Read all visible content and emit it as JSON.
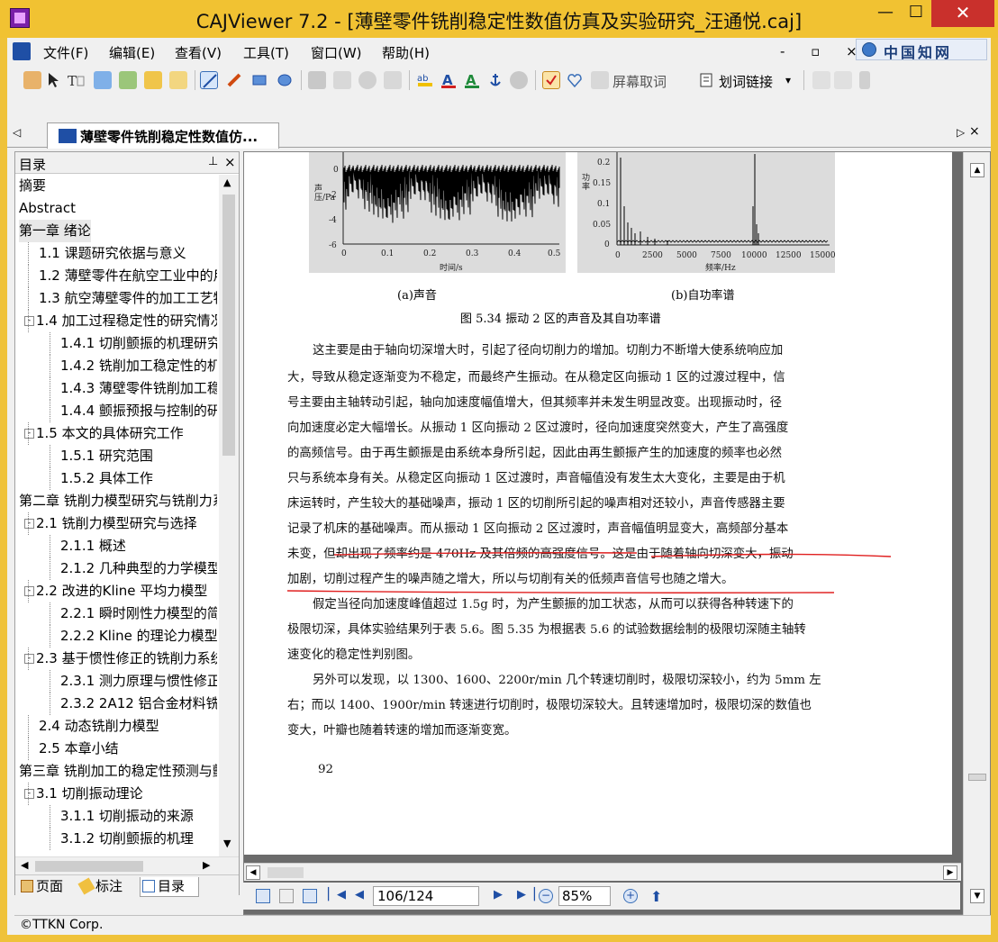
{
  "window": {
    "title": "CAJViewer 7.2 - [薄壁零件铣削稳定性数值仿真及实验研究_汪通悦.caj]",
    "minimize": "—",
    "maximize": "☐",
    "close": "✕"
  },
  "menu": {
    "items": [
      "文件(F)",
      "编辑(E)",
      "查看(V)",
      "工具(T)",
      "窗口(W)",
      "帮助(H)"
    ],
    "mdi_controls": "- ▫ ×",
    "cnki_label": "中国知网"
  },
  "toolbar": {
    "screen_translate_label": "屏幕取词",
    "word_link_label": "划词链接",
    "dropdown_arrow": "▾"
  },
  "doc_tab": {
    "title": "薄壁零件铣削稳定性数值仿...",
    "prev_arrow": "◁",
    "next_arrow": "▷",
    "close": "×"
  },
  "sidebar": {
    "title": "目录",
    "pin": "⊥",
    "close": "×",
    "toc": [
      {
        "label": "摘要",
        "level": 0
      },
      {
        "label": "Abstract",
        "level": 0
      },
      {
        "label": "第一章 绪论",
        "level": 0,
        "selected": true
      },
      {
        "label": "1.1 课题研究依据与意义",
        "level": 1
      },
      {
        "label": "1.2 薄壁零件在航空工业中的用",
        "level": 1
      },
      {
        "label": "1.3 航空薄壁零件的加工工艺特",
        "level": 1
      },
      {
        "label": "1.4 加工过程稳定性的研究情况",
        "level": 1,
        "expander": "-"
      },
      {
        "label": "1.4.1 切削颤振的机理研究",
        "level": 2
      },
      {
        "label": "1.4.2 铣削加工稳定性的机",
        "level": 2
      },
      {
        "label": "1.4.3 薄壁零件铣削加工稳",
        "level": 2
      },
      {
        "label": "1.4.4 颤振预报与控制的研",
        "level": 2
      },
      {
        "label": "1.5 本文的具体研究工作",
        "level": 1,
        "expander": "-"
      },
      {
        "label": "1.5.1 研究范围",
        "level": 2
      },
      {
        "label": "1.5.2 具体工作",
        "level": 2
      },
      {
        "label": "第二章 铣削力模型研究与铣削力系",
        "level": 0
      },
      {
        "label": "2.1 铣削力模型研究与选择",
        "level": 1,
        "expander": "-"
      },
      {
        "label": "2.1.1 概述",
        "level": 2
      },
      {
        "label": "2.1.2 几种典型的力学模型",
        "level": 2
      },
      {
        "label": "2.2 改进的Kline 平均力模型",
        "level": 1,
        "expander": "-"
      },
      {
        "label": "2.2.1 瞬时刚性力模型的简",
        "level": 2
      },
      {
        "label": "2.2.2 Kline 的理论力模型",
        "level": 2
      },
      {
        "label": "2.3 基于惯性修正的铣削力系统",
        "level": 1,
        "expander": "-"
      },
      {
        "label": "2.3.1 测力原理与惯性修正",
        "level": 2
      },
      {
        "label": "2.3.2 2A12 铝合金材料铣",
        "level": 2
      },
      {
        "label": "2.4 动态铣削力模型",
        "level": 1
      },
      {
        "label": "2.5 本章小结",
        "level": 1
      },
      {
        "label": "第三章 铣削加工的稳定性预测与颤",
        "level": 0
      },
      {
        "label": "3.1 切削振动理论",
        "level": 1,
        "expander": "-"
      },
      {
        "label": "3.1.1 切削振动的来源",
        "level": 2
      },
      {
        "label": "3.1.2 切削颤振的机理",
        "level": 2
      }
    ],
    "tabs": [
      "页面",
      "标注",
      "目录"
    ],
    "active_tab": 2
  },
  "navigation": {
    "page_value": "106/124",
    "zoom_value": "85%"
  },
  "status": {
    "text": "©TTKN Corp."
  },
  "page": {
    "figure_a": {
      "caption": "(a)声音",
      "ylabel": "声压/Pa",
      "xlabel": "时间/s",
      "yticks": [
        "0",
        "-2",
        "-4",
        "-6"
      ],
      "xticks": [
        "0",
        "0.1",
        "0.2",
        "0.3",
        "0.4",
        "0.5"
      ]
    },
    "figure_b": {
      "caption": "(b)自功率谱",
      "ylabel": "功率",
      "xlabel": "频率/Hz",
      "yticks": [
        "0.2",
        "0.15",
        "0.1",
        "0.05",
        "0"
      ],
      "xticks": [
        "0",
        "2500",
        "5000",
        "7500",
        "10000",
        "12500",
        "15000"
      ]
    },
    "figure_caption": "图 5.34   振动 2 区的声音及其自功率谱",
    "lines": [
      "这主要是由于轴向切深增大时，引起了径向切削力的增加。切削力不断增大使系统响应加",
      "大，导致从稳定逐渐变为不稳定，而最终产生振动。在从稳定区向振动 1 区的过渡过程中，信",
      "号主要由主轴转动引起，轴向加速度幅值增大，但其频率并未发生明显改变。出现振动时，径",
      "向加速度必定大幅增长。从振动 1 区向振动 2 区过渡时，径向加速度突然变大，产生了高强度",
      "的高频信号。由于再生颤振是由系统本身所引起，因此由再生颤振产生的加速度的频率也必然",
      "只与系统本身有关。从稳定区向振动 1 区过渡时，声音幅值没有发生太大变化，主要是由于机",
      "床运转时，产生较大的基础噪声，振动 1 区的切削所引起的噪声相对还较小，声音传感器主要",
      "记录了机床的基础噪声。而从振动 1 区向振动 2 区过渡时，声音幅值明显变大，高频部分基本",
      "未变，但却出现了频率约是 470Hz 及其倍频的高强度信号。这是由于随着轴向切深变大，振动",
      "加剧，切削过程产生的噪声随之增大，所以与切削有关的低频声音信号也随之增大。",
      "假定当径向加速度峰值超过 1.5g 时，为产生颤振的加工状态，从而可以获得各种转速下的",
      "极限切深，具体实验结果列于表 5.6。图 5.35 为根据表 5.6 的试验数据绘制的极限切深随主轴转",
      "速变化的稳定性判别图。",
      "另外可以发现，以 1300、1600、2200r/min 几个转速切削时，极限切深较小，约为 5mm 左",
      "右；而以 1400、1900r/min 转速进行切削时，极限切深较大。且转速增加时，极限切深的数值也",
      "变大，叶瓣也随着转速的增加而逐渐变宽。"
    ],
    "page_number": "92"
  }
}
